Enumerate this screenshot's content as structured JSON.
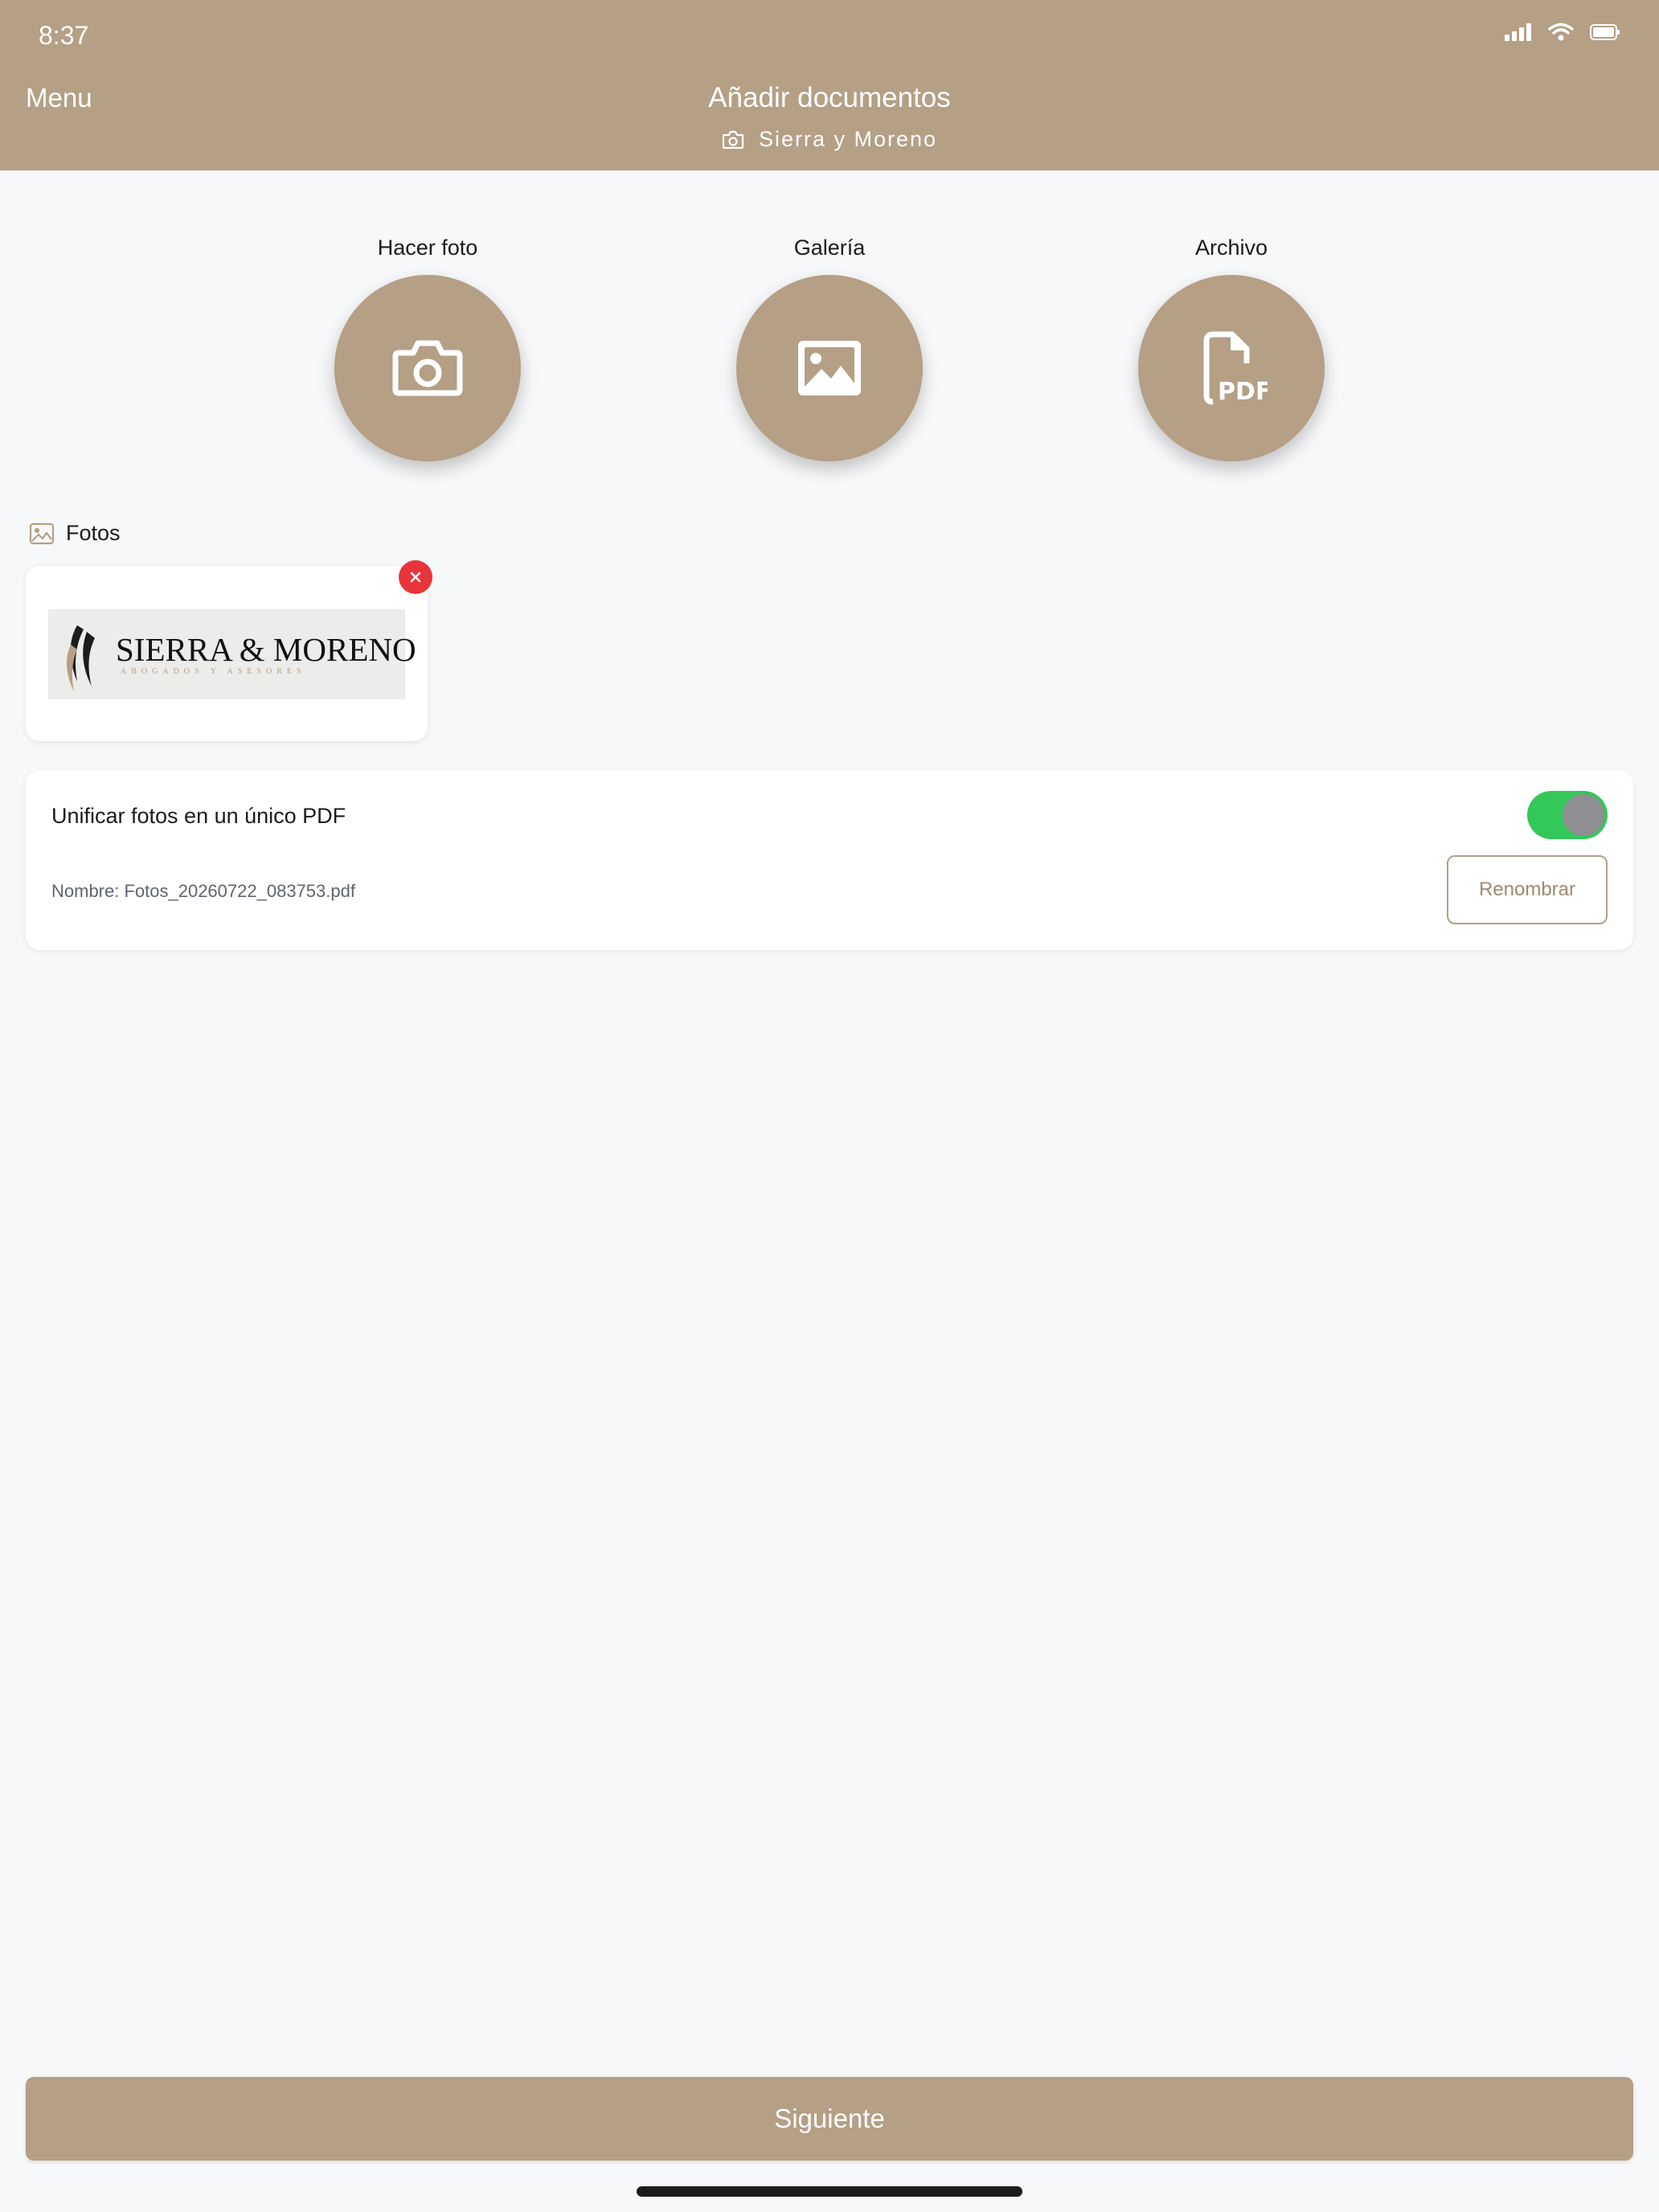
{
  "status_bar": {
    "time": "8:37",
    "icons": [
      "signal-icon",
      "wifi-icon",
      "battery-icon"
    ]
  },
  "header": {
    "menu_label": "Menu",
    "title": "Añadir documentos",
    "subtitle": "Sierra y Moreno",
    "subtitle_icon": "camera-icon"
  },
  "actions": [
    {
      "label": "Hacer foto",
      "icon": "camera-icon"
    },
    {
      "label": "Galería",
      "icon": "image-icon"
    },
    {
      "label": "Archivo",
      "icon": "pdf-file-icon"
    }
  ],
  "photos_section": {
    "title": "Fotos",
    "icon": "image-icon",
    "items": [
      {
        "logo_text": "SIERRA & MORENO",
        "logo_subtext": "ABOGADOS Y ASESORES",
        "remove_icon": "close-icon"
      }
    ]
  },
  "merge_options": {
    "label": "Unificar fotos en un único PDF",
    "enabled": true,
    "filename": "Nombre: Fotos_20260722_083753.pdf",
    "rename_label": "Renombrar"
  },
  "footer": {
    "next_label": "Siguiente"
  },
  "colors": {
    "brand": "#b59f85",
    "background": "#f7f8fa",
    "toggle_on": "#34c759",
    "remove": "#e8353b"
  }
}
